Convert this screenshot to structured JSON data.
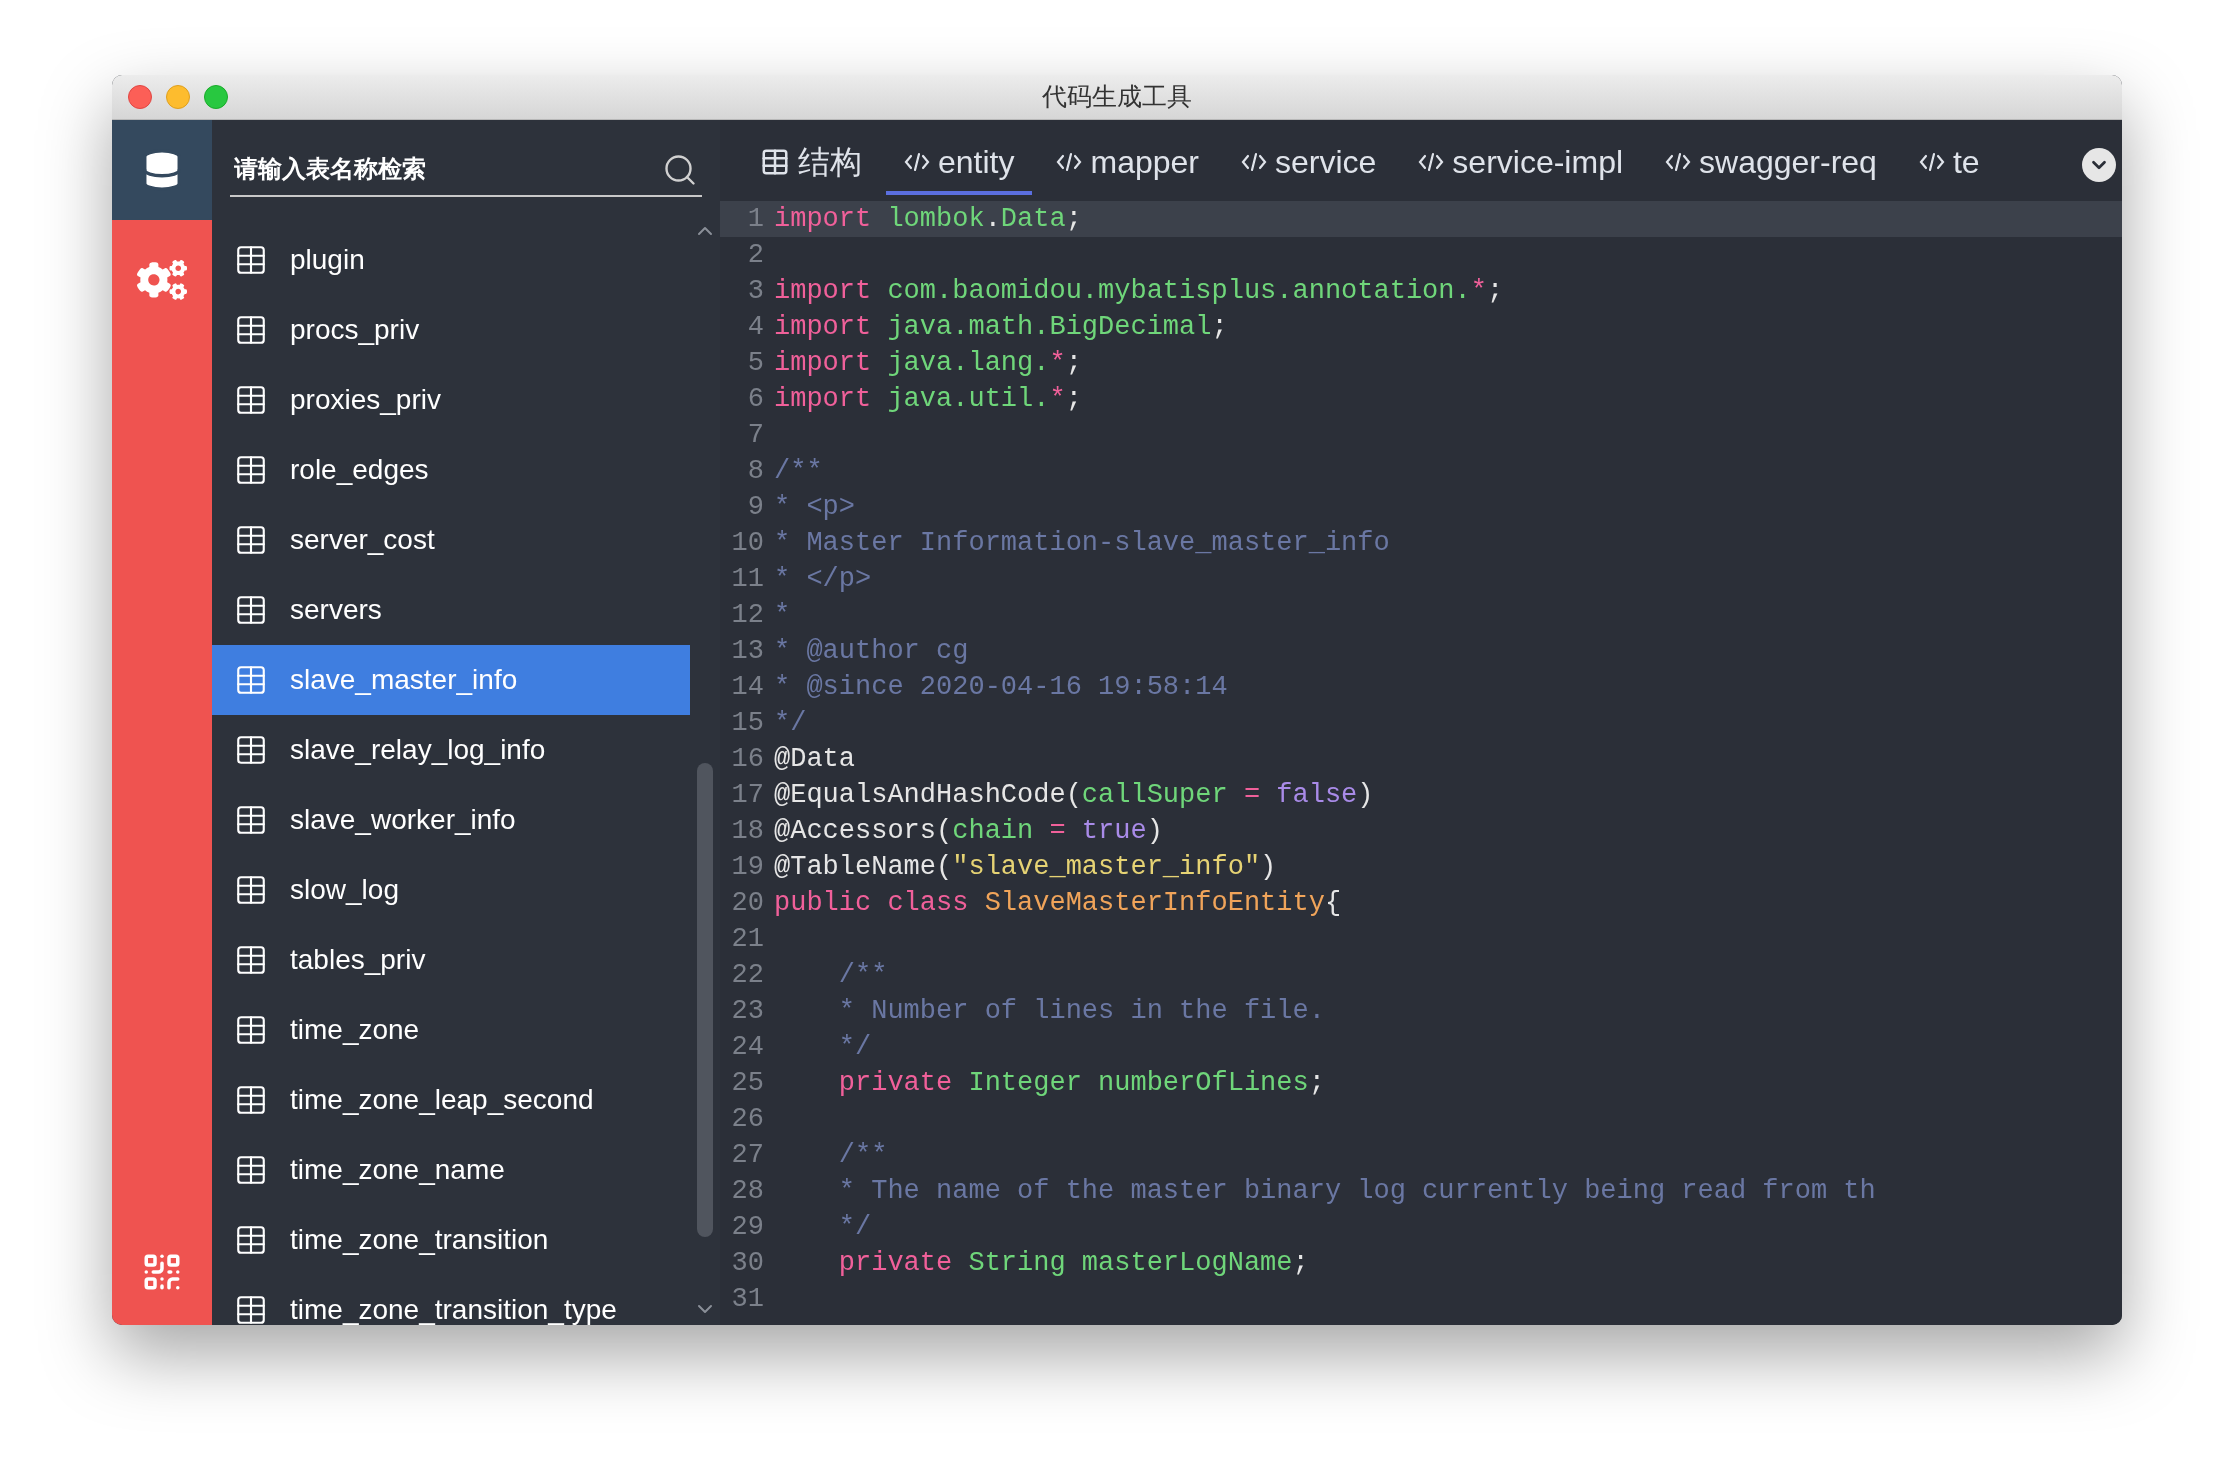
{
  "window": {
    "title": "代码生成工具"
  },
  "search": {
    "placeholder": "请输入表名称检索"
  },
  "tables": [
    {
      "name": "plugin",
      "selected": false
    },
    {
      "name": "procs_priv",
      "selected": false
    },
    {
      "name": "proxies_priv",
      "selected": false
    },
    {
      "name": "role_edges",
      "selected": false
    },
    {
      "name": "server_cost",
      "selected": false
    },
    {
      "name": "servers",
      "selected": false
    },
    {
      "name": "slave_master_info",
      "selected": true
    },
    {
      "name": "slave_relay_log_info",
      "selected": false
    },
    {
      "name": "slave_worker_info",
      "selected": false
    },
    {
      "name": "slow_log",
      "selected": false
    },
    {
      "name": "tables_priv",
      "selected": false
    },
    {
      "name": "time_zone",
      "selected": false
    },
    {
      "name": "time_zone_leap_second",
      "selected": false
    },
    {
      "name": "time_zone_name",
      "selected": false
    },
    {
      "name": "time_zone_transition",
      "selected": false
    },
    {
      "name": "time_zone_transition_type",
      "selected": false
    }
  ],
  "tabs": [
    {
      "kind": "table",
      "label": "结构",
      "selected": false
    },
    {
      "kind": "code",
      "label": "entity",
      "selected": true
    },
    {
      "kind": "code",
      "label": "mapper",
      "selected": false
    },
    {
      "kind": "code",
      "label": "service",
      "selected": false
    },
    {
      "kind": "code",
      "label": "service-impl",
      "selected": false
    },
    {
      "kind": "code",
      "label": "swagger-req",
      "selected": false
    },
    {
      "kind": "code",
      "label": "te",
      "selected": false
    }
  ],
  "code": [
    {
      "number": "1",
      "selected": true,
      "tokens": [
        {
          "kind": "keyword",
          "text": "import "
        },
        {
          "kind": "name",
          "text": "lombok"
        },
        {
          "kind": "plain",
          "text": "."
        },
        {
          "kind": "name",
          "text": "Data"
        },
        {
          "kind": "plain",
          "text": ";"
        }
      ]
    },
    {
      "number": "2",
      "selected": false
    },
    {
      "number": "3",
      "selected": false,
      "tokens": [
        {
          "kind": "keyword",
          "text": "import "
        },
        {
          "kind": "name",
          "text": "com.baomidou.mybatisplus.annotation."
        },
        {
          "kind": "keyword",
          "text": "*"
        },
        {
          "kind": "plain",
          "text": ";"
        }
      ]
    },
    {
      "number": "4",
      "selected": false,
      "tokens": [
        {
          "kind": "keyword",
          "text": "import "
        },
        {
          "kind": "name",
          "text": "java.math.BigDecimal"
        },
        {
          "kind": "plain",
          "text": ";"
        }
      ]
    },
    {
      "number": "5",
      "selected": false,
      "tokens": [
        {
          "kind": "keyword",
          "text": "import "
        },
        {
          "kind": "name",
          "text": "java.lang."
        },
        {
          "kind": "keyword",
          "text": "*"
        },
        {
          "kind": "plain",
          "text": ";"
        }
      ]
    },
    {
      "number": "6",
      "selected": false,
      "tokens": [
        {
          "kind": "keyword",
          "text": "import "
        },
        {
          "kind": "name",
          "text": "java.util."
        },
        {
          "kind": "keyword",
          "text": "*"
        },
        {
          "kind": "plain",
          "text": ";"
        }
      ]
    },
    {
      "number": "7",
      "selected": false
    },
    {
      "number": "8",
      "selected": false,
      "tokens": [
        {
          "kind": "comment",
          "text": "/**"
        }
      ]
    },
    {
      "number": "9",
      "selected": false,
      "tokens": [
        {
          "kind": "comment",
          "text": "* <p>"
        }
      ]
    },
    {
      "number": "10",
      "selected": false,
      "tokens": [
        {
          "kind": "comment",
          "text": "* Master Information-slave_master_info"
        }
      ]
    },
    {
      "number": "11",
      "selected": false,
      "tokens": [
        {
          "kind": "comment",
          "text": "* </p>"
        }
      ]
    },
    {
      "number": "12",
      "selected": false,
      "tokens": [
        {
          "kind": "comment",
          "text": "*"
        }
      ]
    },
    {
      "number": "13",
      "selected": false,
      "tokens": [
        {
          "kind": "comment",
          "text": "* @author cg"
        }
      ]
    },
    {
      "number": "14",
      "selected": false,
      "tokens": [
        {
          "kind": "comment",
          "text": "* @since 2020-04-16 19:58:14"
        }
      ]
    },
    {
      "number": "15",
      "selected": false,
      "tokens": [
        {
          "kind": "comment",
          "text": "*/"
        }
      ]
    },
    {
      "number": "16",
      "selected": false,
      "tokens": [
        {
          "kind": "plain",
          "text": "@Data"
        }
      ]
    },
    {
      "number": "17",
      "selected": false,
      "tokens": [
        {
          "kind": "plain",
          "text": "@EqualsAndHashCode("
        },
        {
          "kind": "name",
          "text": "callSuper "
        },
        {
          "kind": "keyword",
          "text": "= "
        },
        {
          "kind": "constant",
          "text": "false"
        },
        {
          "kind": "plain",
          "text": ")"
        }
      ]
    },
    {
      "number": "18",
      "selected": false,
      "tokens": [
        {
          "kind": "plain",
          "text": "@Accessors("
        },
        {
          "kind": "name",
          "text": "chain "
        },
        {
          "kind": "keyword",
          "text": "= "
        },
        {
          "kind": "constant",
          "text": "true"
        },
        {
          "kind": "plain",
          "text": ")"
        }
      ]
    },
    {
      "number": "19",
      "selected": false,
      "tokens": [
        {
          "kind": "plain",
          "text": "@TableName("
        },
        {
          "kind": "string",
          "text": "\"slave_master_info\""
        },
        {
          "kind": "plain",
          "text": ")"
        }
      ]
    },
    {
      "number": "20",
      "selected": false,
      "tokens": [
        {
          "kind": "keyword",
          "text": "public class "
        },
        {
          "kind": "type",
          "text": "SlaveMasterInfoEntity"
        },
        {
          "kind": "plain",
          "text": "{"
        }
      ]
    },
    {
      "number": "21",
      "selected": false
    },
    {
      "number": "22",
      "selected": false,
      "tokens": [
        {
          "kind": "comment",
          "text": "    /**"
        }
      ]
    },
    {
      "number": "23",
      "selected": false,
      "tokens": [
        {
          "kind": "comment",
          "text": "    * Number of lines in the file."
        }
      ]
    },
    {
      "number": "24",
      "selected": false,
      "tokens": [
        {
          "kind": "comment",
          "text": "    */"
        }
      ]
    },
    {
      "number": "25",
      "selected": false,
      "tokens": [
        {
          "kind": "keyword",
          "text": "    private "
        },
        {
          "kind": "name",
          "text": "Integer numberOfLines"
        },
        {
          "kind": "plain",
          "text": ";"
        }
      ]
    },
    {
      "number": "26",
      "selected": false
    },
    {
      "number": "27",
      "selected": false,
      "tokens": [
        {
          "kind": "comment",
          "text": "    /**"
        }
      ]
    },
    {
      "number": "28",
      "selected": false,
      "tokens": [
        {
          "kind": "comment",
          "text": "    * The name of the master binary log currently being read from th"
        }
      ]
    },
    {
      "number": "29",
      "selected": false,
      "tokens": [
        {
          "kind": "comment",
          "text": "    */"
        }
      ]
    },
    {
      "number": "30",
      "selected": false,
      "tokens": [
        {
          "kind": "keyword",
          "text": "    private "
        },
        {
          "kind": "name",
          "text": "String masterLogName"
        },
        {
          "kind": "plain",
          "text": ";"
        }
      ]
    },
    {
      "number": "31",
      "selected": false
    }
  ]
}
